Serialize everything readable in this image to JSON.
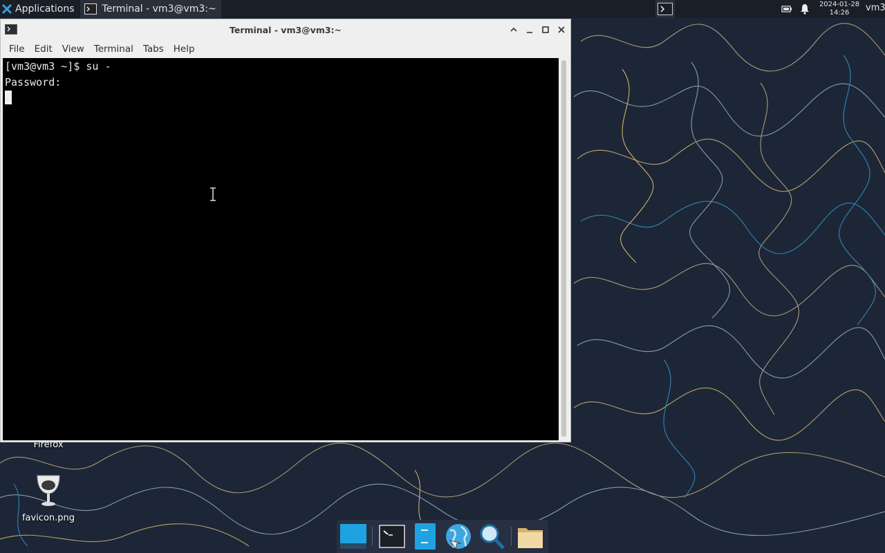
{
  "panel": {
    "applications_label": "Applications",
    "taskbar_item": "Terminal - vm3@vm3:~",
    "clock_date": "2024-01-28",
    "clock_time": "14:26",
    "user": "vm3"
  },
  "window": {
    "title": "Terminal - vm3@vm3:~",
    "menu": [
      "File",
      "Edit",
      "View",
      "Terminal",
      "Tabs",
      "Help"
    ]
  },
  "terminal": {
    "lines": [
      "[vm3@vm3 ~]$ su -",
      "Password:"
    ]
  },
  "desktop": {
    "icons": [
      {
        "label": "Firefox"
      },
      {
        "label": "favicon.png"
      }
    ]
  },
  "dock": {
    "items": [
      "show-desktop",
      "terminal",
      "file-manager",
      "web-browser",
      "app-finder",
      "home-folder"
    ]
  },
  "colors": {
    "panel_bg": "#1a1f27",
    "wallpaper_bg": "#1d2636",
    "terminal_bg": "#000000",
    "terminal_fg": "#e9e9e9",
    "accent": "#1fa3e0"
  }
}
